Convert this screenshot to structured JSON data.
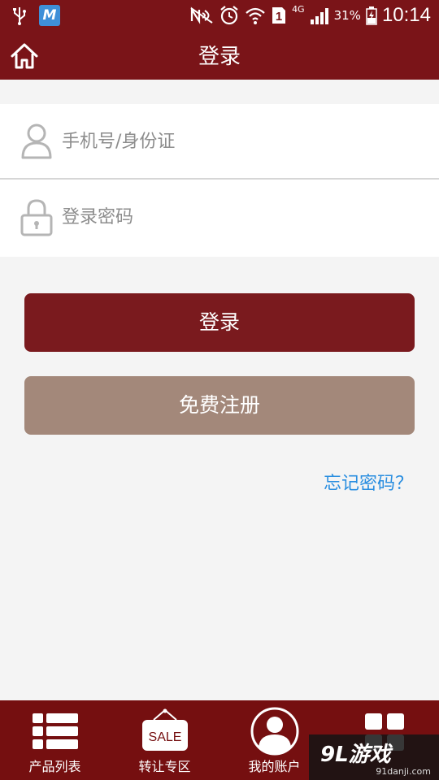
{
  "status_bar": {
    "network": "4G",
    "sim_slot": "1",
    "battery": "31%",
    "time": "10:14"
  },
  "header": {
    "title": "登录"
  },
  "form": {
    "phone_placeholder": "手机号/身份证",
    "password_placeholder": "登录密码"
  },
  "buttons": {
    "login": "登录",
    "register": "免费注册"
  },
  "forgot_password": "忘记密码？",
  "bottom_nav": {
    "items": [
      {
        "label": "产品列表",
        "icon": "list-icon"
      },
      {
        "label": "转让专区",
        "icon": "sale-tag-icon",
        "badge": "SALE"
      },
      {
        "label": "我的账户",
        "icon": "user-circle-icon"
      },
      {
        "label": "",
        "icon": "grid-icon"
      }
    ]
  },
  "watermark": {
    "brand": "9L游戏",
    "url": "91danji.com"
  },
  "colors": {
    "primary": "#7a1418",
    "secondary_button": "#a3887a",
    "link": "#2a8ee0",
    "nav_bg": "#750f10"
  }
}
